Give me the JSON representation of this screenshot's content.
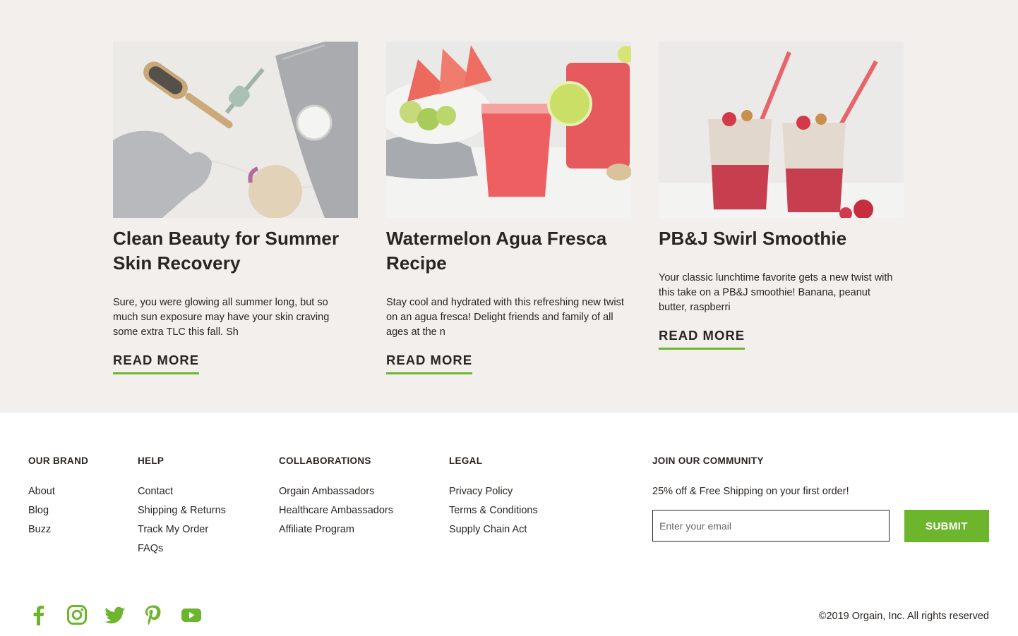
{
  "colors": {
    "accent": "#6cb52d",
    "section_bg": "#f2efec",
    "text": "#2a2522"
  },
  "articles": [
    {
      "title": "Clean Beauty for Summer Skin Recovery",
      "excerpt": "Sure, you were glowing all summer long, but so much sun exposure may have your skin craving some extra TLC this fall. Sh",
      "cta": "READ MORE",
      "image": "beauty-tools-flatlay"
    },
    {
      "title": "Watermelon Agua Fresca Recipe",
      "excerpt": "Stay cool and hydrated with this refreshing new twist on an agua fresca! Delight friends and family of all ages at the n",
      "cta": "READ MORE",
      "image": "watermelon-drinks"
    },
    {
      "title": "PB&J Swirl Smoothie",
      "excerpt": "Your classic lunchtime favorite gets a new twist with this take on a PB&J smoothie! Banana, peanut butter, raspberri",
      "cta": "READ MORE",
      "image": "pbj-smoothies"
    }
  ],
  "footer": {
    "our_brand": {
      "heading": "OUR BRAND",
      "links": [
        "About",
        "Blog",
        "Buzz"
      ]
    },
    "help": {
      "heading": "HELP",
      "links": [
        "Contact",
        "Shipping & Returns",
        "Track My Order",
        "FAQs"
      ]
    },
    "collaborations": {
      "heading": "COLLABORATIONS",
      "links": [
        "Orgain Ambassadors",
        "Healthcare Ambassadors",
        "Affiliate Program"
      ]
    },
    "legal": {
      "heading": "LEGAL",
      "links": [
        "Privacy Policy",
        "Terms & Conditions",
        "Supply Chain Act"
      ]
    },
    "community": {
      "heading": "JOIN OUR COMMUNITY",
      "offer": "25% off & Free Shipping on your first order!",
      "email_placeholder": "Enter your email",
      "email_value": "",
      "submit_label": "SUBMIT"
    },
    "social_icons": [
      "facebook-icon",
      "instagram-icon",
      "twitter-icon",
      "pinterest-icon",
      "youtube-icon"
    ],
    "copyright": "©2019 Orgain, Inc. All rights reserved"
  }
}
